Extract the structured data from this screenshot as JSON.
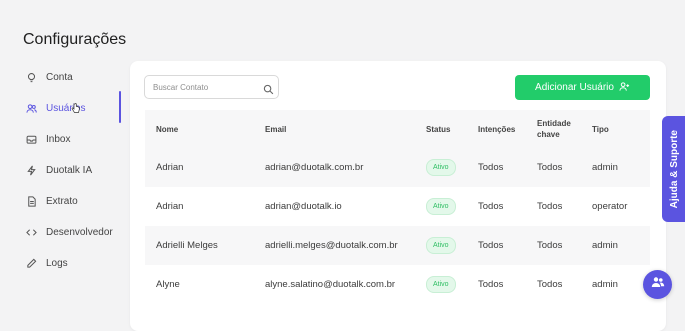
{
  "page": {
    "title": "Configurações"
  },
  "sidebar": {
    "items": [
      {
        "label": "Conta",
        "icon": "lightbulb-icon"
      },
      {
        "label": "Usuários",
        "icon": "users-icon",
        "active": true
      },
      {
        "label": "Inbox",
        "icon": "inbox-icon"
      },
      {
        "label": "Duotalk IA",
        "icon": "lightning-icon"
      },
      {
        "label": "Extrato",
        "icon": "document-icon"
      },
      {
        "label": "Desenvolvedor",
        "icon": "code-icon"
      },
      {
        "label": "Logs",
        "icon": "logs-icon"
      }
    ]
  },
  "search": {
    "placeholder": "Buscar Contato",
    "value": ""
  },
  "add_button": {
    "label": "Adicionar Usuário"
  },
  "table": {
    "headers": [
      "Nome",
      "Email",
      "Status",
      "Intenções",
      "Entidade chave",
      "Tipo"
    ],
    "rows": [
      {
        "name": "Adrian",
        "email": "adrian@duotalk.com.br",
        "status": "Ativo",
        "intents": "Todos",
        "entity": "Todos",
        "type": "admin"
      },
      {
        "name": "Adrian",
        "email": "adrian@duotalk.io",
        "status": "Ativo",
        "intents": "Todos",
        "entity": "Todos",
        "type": "operator"
      },
      {
        "name": "Adrielli Melges",
        "email": "adrielli.melges@duotalk.com.br",
        "status": "Ativo",
        "intents": "Todos",
        "entity": "Todos",
        "type": "admin"
      },
      {
        "name": "Alyne",
        "email": "alyne.salatino@duotalk.com.br",
        "status": "Ativo",
        "intents": "Todos",
        "entity": "Todos",
        "type": "admin"
      }
    ]
  },
  "help": {
    "label": "Ajuda & Suporte"
  },
  "colors": {
    "accent": "#5b54e0",
    "primary_button": "#22cc6a",
    "badge_bg": "#e3f8ea",
    "badge_text": "#2fbf64"
  }
}
